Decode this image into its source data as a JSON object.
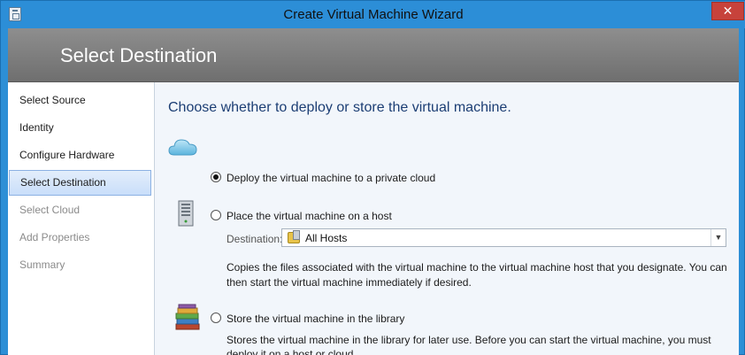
{
  "window": {
    "title": "Create Virtual Machine Wizard",
    "close_glyph": "✕"
  },
  "banner": {
    "title": "Select Destination"
  },
  "nav": {
    "items": [
      {
        "label": "Select Source",
        "state": "normal"
      },
      {
        "label": "Identity",
        "state": "normal"
      },
      {
        "label": "Configure Hardware",
        "state": "normal"
      },
      {
        "label": "Select Destination",
        "state": "selected"
      },
      {
        "label": "Select Cloud",
        "state": "disabled"
      },
      {
        "label": "Add Properties",
        "state": "disabled"
      },
      {
        "label": "Summary",
        "state": "disabled"
      }
    ]
  },
  "content": {
    "heading": "Choose whether to deploy or store the virtual machine.",
    "options": [
      {
        "label": "Deploy the virtual machine to a private cloud",
        "icon": "cloud-icon",
        "checked": true
      },
      {
        "label": "Place the virtual machine on a host",
        "icon": "server-icon",
        "checked": false,
        "destination_label": "Destination:",
        "destination_value": "All Hosts",
        "description_line1": "Copies the files associated with the virtual machine to the virtual machine host that you designate. You can",
        "description_line2": "then start the virtual machine immediately if desired."
      },
      {
        "label": "Store the virtual machine in the library",
        "icon": "library-books-icon",
        "checked": false,
        "description_line1": "Stores the virtual machine in the library for later use. Before you can start the virtual machine, you must",
        "description_line2": "deploy it on a host or cloud."
      }
    ]
  },
  "colors": {
    "titlebar": "#2c8ed7",
    "banner": "#7d7d7d",
    "heading": "#1c3e74",
    "selected_nav": "#c9defa",
    "content_bg": "#f2f6fb"
  }
}
